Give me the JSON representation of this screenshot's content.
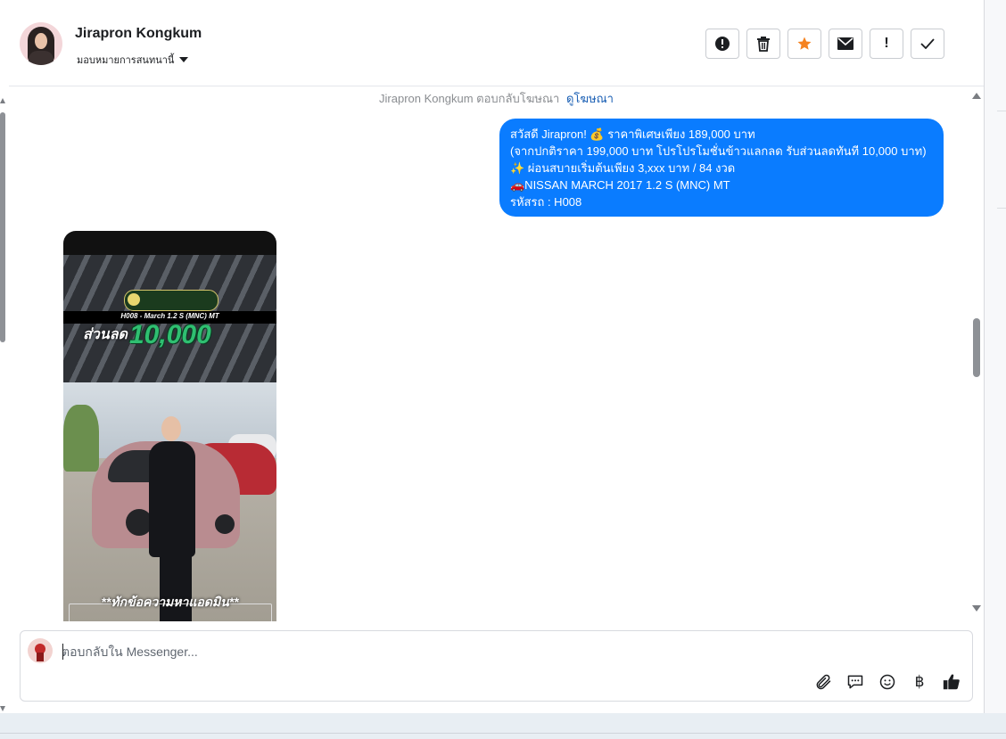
{
  "header": {
    "contact_name": "Jirapron Kongkum",
    "assign_label": "มอบหมายการสนทนานี้",
    "actions": [
      {
        "name": "report-button",
        "icon": "alert-circle-icon"
      },
      {
        "name": "delete-button",
        "icon": "trash-icon"
      },
      {
        "name": "star-button",
        "icon": "star-icon"
      },
      {
        "name": "mark-unread-button",
        "icon": "envelope-icon"
      },
      {
        "name": "follow-up-button",
        "icon": "exclamation-icon"
      },
      {
        "name": "done-button",
        "icon": "checkmark-icon"
      }
    ],
    "star_color": "#f5821f"
  },
  "conversation": {
    "reply_note": "Jirapron Kongkum ตอบกลับโฆษณา",
    "reply_link": "ดูโฆษณา",
    "message": {
      "lines": [
        "สวัสดี Jirapron! 💰 ราคาพิเศษเพียง 189,000 บาท",
        "(จากปกติราคา 199,000 บาท โปรโปรโมชั่นข้าวแลกลด รับส่วนลดทันที 10,000 บาท)",
        "✨ ผ่อนสบายเริ่มต้นเพียง 3,xxx บาท / 84 งวด",
        "🚗NISSAN MARCH 2017 1.2 S (MNC) MT",
        " รหัสรถ : H008"
      ],
      "bubble_color": "#0a7cff"
    },
    "media": {
      "code_text": "H008 - March 1.2 S (MNC) MT",
      "discount_label": "ส่วนลด",
      "discount_value": "10,000",
      "caption": "**ทักข้อความหาแอดมิน**"
    }
  },
  "composer": {
    "placeholder": "ตอบกลับใน Messenger...",
    "tools": [
      "paperclip-icon",
      "chat-bubble-icon",
      "emoji-icon",
      "baht-icon",
      "thumbs-up-icon"
    ],
    "baht_symbol": "฿"
  }
}
